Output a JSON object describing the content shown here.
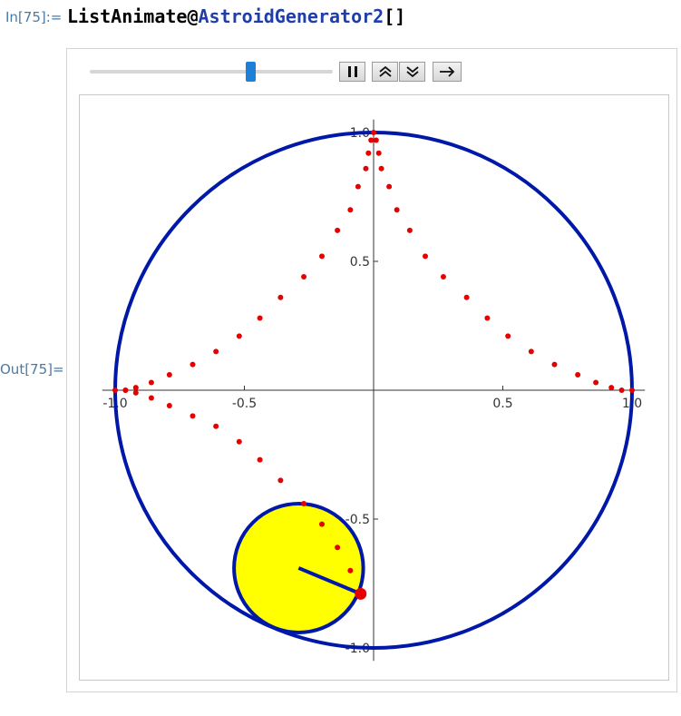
{
  "cell": {
    "in_label": "In[75]:=",
    "input_fn1": "ListAnimate",
    "input_at": "@",
    "input_fn2": "AstroidGenerator2",
    "input_args": "[]",
    "out_label": "Out[75]="
  },
  "controls": {
    "slider_value": 0.67,
    "pause_icon": "pause-icon",
    "faster_icon": "double-chevron-up-icon",
    "slower_icon": "double-chevron-down-icon",
    "direction_icon": "right-arrow-icon"
  },
  "chart_data": {
    "type": "scatter",
    "xlim": [
      -1.05,
      1.05
    ],
    "ylim": [
      -1.05,
      1.05
    ],
    "x_ticks": [
      {
        "value": -1.0,
        "label": "-1.0"
      },
      {
        "value": -0.5,
        "label": "-0.5"
      },
      {
        "value": 0.5,
        "label": "0.5"
      },
      {
        "value": 1.0,
        "label": "1.0"
      }
    ],
    "y_ticks": [
      {
        "value": 1.0,
        "label": "1.0"
      },
      {
        "value": 0.5,
        "label": "0.5"
      },
      {
        "value": -0.5,
        "label": "-0.5"
      },
      {
        "value": -1.0,
        "label": "-1.0"
      }
    ],
    "outer_circle": {
      "center": [
        0,
        0
      ],
      "radius": 1.0
    },
    "rolling_circle": {
      "center": [
        -0.29,
        -0.69
      ],
      "radius": 0.25
    },
    "rolling_segment": {
      "from": [
        -0.29,
        -0.69
      ],
      "to": [
        -0.05,
        -0.79
      ]
    },
    "marker_point": [
      -0.05,
      -0.79
    ],
    "points": [
      [
        -1.0,
        0.0
      ],
      [
        -0.96,
        0.0
      ],
      [
        -0.92,
        0.01
      ],
      [
        -0.86,
        0.03
      ],
      [
        -0.79,
        0.06
      ],
      [
        -0.7,
        0.1
      ],
      [
        -0.61,
        0.15
      ],
      [
        -0.52,
        0.21
      ],
      [
        -0.44,
        0.28
      ],
      [
        -0.36,
        0.36
      ],
      [
        -0.27,
        0.44
      ],
      [
        -0.2,
        0.52
      ],
      [
        -0.14,
        0.62
      ],
      [
        -0.09,
        0.7
      ],
      [
        -0.06,
        0.79
      ],
      [
        -0.03,
        0.86
      ],
      [
        -0.02,
        0.92
      ],
      [
        -0.01,
        0.97
      ],
      [
        0.0,
        1.0
      ],
      [
        0.01,
        0.97
      ],
      [
        0.02,
        0.92
      ],
      [
        0.03,
        0.86
      ],
      [
        0.06,
        0.79
      ],
      [
        0.09,
        0.7
      ],
      [
        0.14,
        0.62
      ],
      [
        0.2,
        0.52
      ],
      [
        0.27,
        0.44
      ],
      [
        0.36,
        0.36
      ],
      [
        0.44,
        0.28
      ],
      [
        0.52,
        0.21
      ],
      [
        0.61,
        0.15
      ],
      [
        0.7,
        0.1
      ],
      [
        0.79,
        0.06
      ],
      [
        0.86,
        0.03
      ],
      [
        0.92,
        0.01
      ],
      [
        0.96,
        0.0
      ],
      [
        1.0,
        0.0
      ],
      [
        -0.96,
        0.0
      ],
      [
        -0.92,
        -0.01
      ],
      [
        -0.86,
        -0.03
      ],
      [
        -0.79,
        -0.06
      ],
      [
        -0.7,
        -0.1
      ],
      [
        -0.61,
        -0.14
      ],
      [
        -0.52,
        -0.2
      ],
      [
        -0.44,
        -0.27
      ],
      [
        -0.36,
        -0.35
      ],
      [
        -0.27,
        -0.44
      ],
      [
        -0.2,
        -0.52
      ],
      [
        -0.14,
        -0.61
      ],
      [
        -0.09,
        -0.7
      ]
    ],
    "colors": {
      "outer_circle": "#0018a8",
      "rolling_fill": "#ffff00",
      "rolling_stroke": "#0018a8",
      "points": "#e60000",
      "axes": "#333333"
    }
  }
}
